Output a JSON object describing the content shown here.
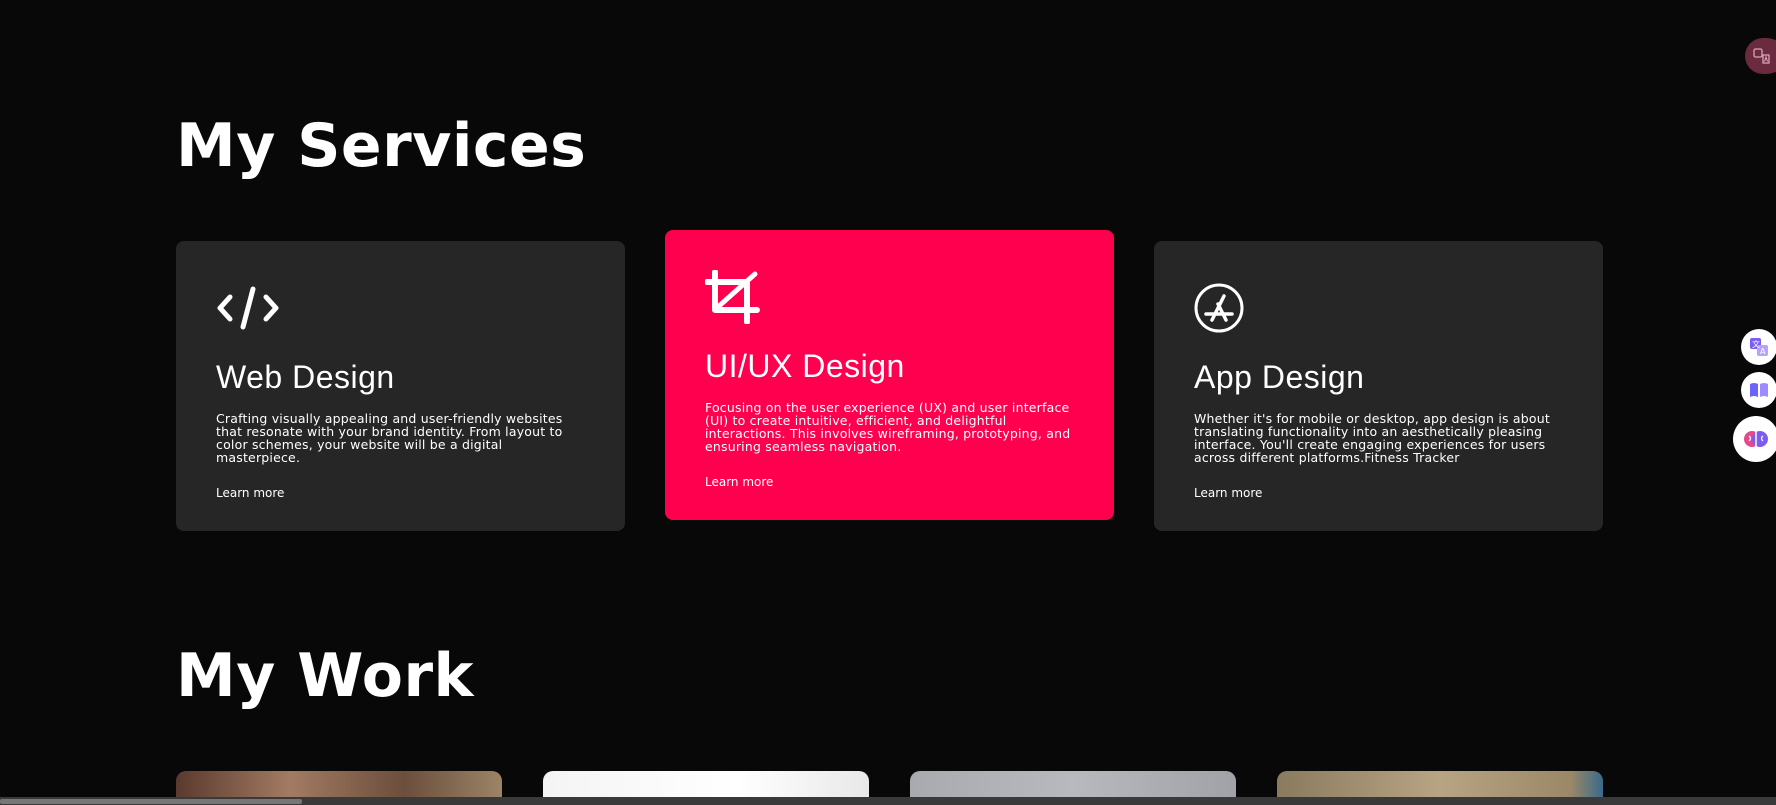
{
  "services": {
    "title": "My Services",
    "cards": [
      {
        "icon": "code-icon",
        "title": "Web Design",
        "description": "Crafting visually appealing and user-friendly websites that resonate with your brand identity. From layout to color schemes, your website will be a digital masterpiece.",
        "link": "Learn more"
      },
      {
        "icon": "crop-icon",
        "title": "UI/UX Design",
        "description": "Focusing on the user experience (UX) and user interface (UI) to create intuitive, efficient, and delightful interactions. This involves wireframing, prototyping, and ensuring seamless navigation.",
        "link": "Learn more"
      },
      {
        "icon": "app-store-icon",
        "title": "App Design",
        "description": "Whether it's for mobile or desktop, app design is about translating functionality into an aesthetically pleasing interface. You'll create engaging experiences for users across different platforms.Fitness Tracker",
        "link": "Learn more"
      }
    ]
  },
  "work": {
    "title": "My Work"
  },
  "colors": {
    "background": "#080808",
    "card": "#262626",
    "accent": "#ff004f"
  },
  "extension_icons": [
    "translate-icon",
    "translate-icon",
    "reader-icon",
    "brain-icon"
  ]
}
